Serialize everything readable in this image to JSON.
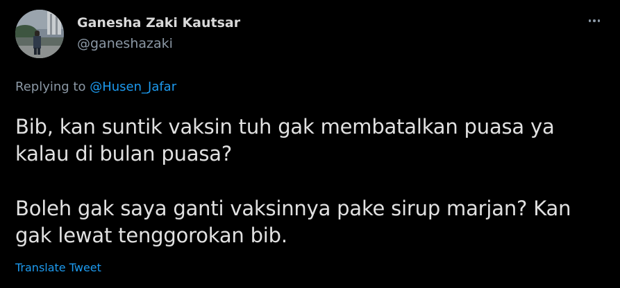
{
  "author": {
    "name": "Ganesha Zaki Kautsar",
    "handle": "@ganeshazaki"
  },
  "reply": {
    "prefix": "Replying to ",
    "mention": "@Husen_Jafar"
  },
  "tweet": {
    "paragraphs": [
      "Bib, kan suntik vaksin tuh gak membatalkan puasa ya kalau di bulan puasa?",
      "Boleh gak saya ganti vaksinnya pake sirup marjan? Kan gak lewat tenggorokan bib."
    ]
  },
  "actions": {
    "translate_label": "Translate Tweet",
    "more_icon": "more-horizontal-icon"
  },
  "colors": {
    "background": "#000000",
    "text": "#e1e1e1",
    "secondary": "#8b98a5",
    "accent": "#1d9bf0"
  }
}
